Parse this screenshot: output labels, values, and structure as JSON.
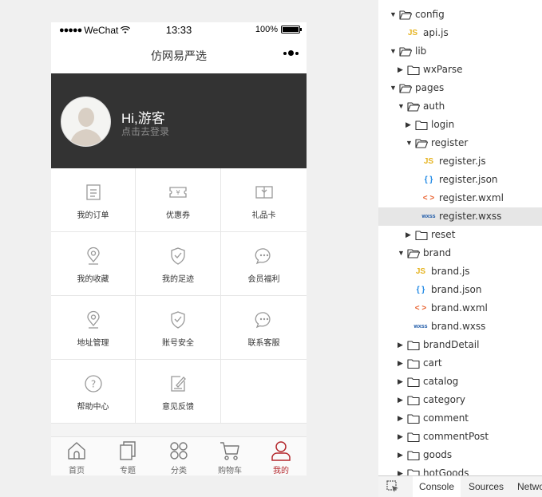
{
  "statusbar": {
    "carrier": "WeChat",
    "time": "13:33",
    "battery": "100%"
  },
  "navbar": {
    "title": "仿网易严选"
  },
  "profile": {
    "greeting": "Hi,游客",
    "login_hint": "点击去登录"
  },
  "menu": [
    {
      "label": "我的订单",
      "icon": "order-list-icon"
    },
    {
      "label": "优惠券",
      "icon": "coupon-icon"
    },
    {
      "label": "礼品卡",
      "icon": "gift-card-icon"
    },
    {
      "label": "我的收藏",
      "icon": "location-pin-icon"
    },
    {
      "label": "我的足迹",
      "icon": "shield-check-icon"
    },
    {
      "label": "会员福利",
      "icon": "chat-bubble-icon"
    },
    {
      "label": "地址管理",
      "icon": "location-pin-icon"
    },
    {
      "label": "账号安全",
      "icon": "shield-check-icon"
    },
    {
      "label": "联系客服",
      "icon": "chat-bubble-icon"
    },
    {
      "label": "帮助中心",
      "icon": "help-circle-icon"
    },
    {
      "label": "意见反馈",
      "icon": "feedback-edit-icon"
    }
  ],
  "tabbar": [
    {
      "label": "首页",
      "icon": "home-icon",
      "active": false
    },
    {
      "label": "专题",
      "icon": "topic-icon",
      "active": false
    },
    {
      "label": "分类",
      "icon": "category-icon",
      "active": false
    },
    {
      "label": "购物车",
      "icon": "cart-icon",
      "active": false
    },
    {
      "label": "我的",
      "icon": "user-icon",
      "active": true
    }
  ],
  "filetree": [
    {
      "name": "config",
      "type": "folder",
      "depth": 0,
      "expanded": true
    },
    {
      "name": "api.js",
      "type": "js",
      "depth": 1
    },
    {
      "name": "lib",
      "type": "folder",
      "depth": 0,
      "expanded": true
    },
    {
      "name": "wxParse",
      "type": "folder",
      "depth": 1,
      "expanded": false
    },
    {
      "name": "pages",
      "type": "folder",
      "depth": 0,
      "expanded": true
    },
    {
      "name": "auth",
      "type": "folder",
      "depth": 1,
      "expanded": true
    },
    {
      "name": "login",
      "type": "folder",
      "depth": 2,
      "expanded": false
    },
    {
      "name": "register",
      "type": "folder",
      "depth": 2,
      "expanded": true
    },
    {
      "name": "register.js",
      "type": "js",
      "depth": 3
    },
    {
      "name": "register.json",
      "type": "json",
      "depth": 3
    },
    {
      "name": "register.wxml",
      "type": "wxml",
      "depth": 3
    },
    {
      "name": "register.wxss",
      "type": "wxss",
      "depth": 3,
      "selected": true
    },
    {
      "name": "reset",
      "type": "folder",
      "depth": 2,
      "expanded": false
    },
    {
      "name": "brand",
      "type": "folder",
      "depth": 1,
      "expanded": true
    },
    {
      "name": "brand.js",
      "type": "js",
      "depth": 2
    },
    {
      "name": "brand.json",
      "type": "json",
      "depth": 2
    },
    {
      "name": "brand.wxml",
      "type": "wxml",
      "depth": 2
    },
    {
      "name": "brand.wxss",
      "type": "wxss",
      "depth": 2
    },
    {
      "name": "brandDetail",
      "type": "folder",
      "depth": 1,
      "expanded": false
    },
    {
      "name": "cart",
      "type": "folder",
      "depth": 1,
      "expanded": false
    },
    {
      "name": "catalog",
      "type": "folder",
      "depth": 1,
      "expanded": false
    },
    {
      "name": "category",
      "type": "folder",
      "depth": 1,
      "expanded": false
    },
    {
      "name": "comment",
      "type": "folder",
      "depth": 1,
      "expanded": false
    },
    {
      "name": "commentPost",
      "type": "folder",
      "depth": 1,
      "expanded": false
    },
    {
      "name": "goods",
      "type": "folder",
      "depth": 1,
      "expanded": false
    },
    {
      "name": "hotGoods",
      "type": "folder",
      "depth": 1,
      "expanded": false
    }
  ],
  "filetype_badges": {
    "js": "JS",
    "json": "{ }",
    "wxml": "< >",
    "wxss": "wxss"
  },
  "devtools_tabs": [
    "Console",
    "Sources",
    "Network"
  ],
  "colors": {
    "header_bg": "#333333",
    "accent": "#b4282d",
    "js": "#e6b422",
    "json": "#1e88e5",
    "wxml": "#e8602c",
    "wxss": "#1e5aa8"
  }
}
